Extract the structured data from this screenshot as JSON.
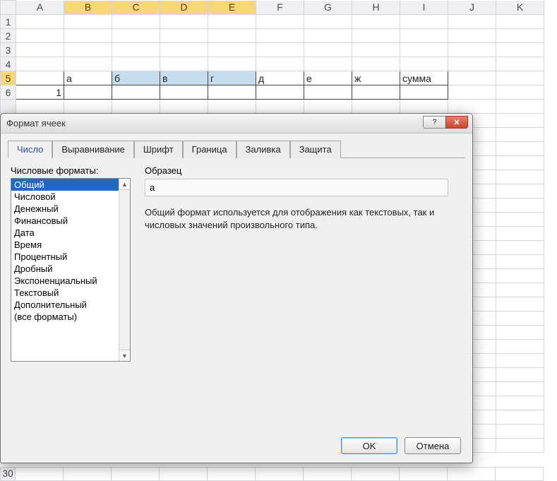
{
  "sheet": {
    "columns": [
      "A",
      "B",
      "C",
      "D",
      "E",
      "F",
      "G",
      "H",
      "I",
      "J",
      "K"
    ],
    "rows_visible": [
      "1",
      "2",
      "3",
      "4",
      "5",
      "6"
    ],
    "bottom_row_label": "30",
    "row5": {
      "A": "",
      "B": "а",
      "C": "б",
      "D": "в",
      "E": "г",
      "F": "д",
      "G": "е",
      "H": "ж",
      "I": "сумма"
    },
    "row6": {
      "A": "1"
    },
    "selected_cols": [
      "B",
      "C",
      "D",
      "E"
    ],
    "selected_row": "5"
  },
  "dialog": {
    "title": "Формат ячеек",
    "tabs": [
      "Число",
      "Выравнивание",
      "Шрифт",
      "Граница",
      "Заливка",
      "Защита"
    ],
    "active_tab": "Число",
    "formats_label": "Числовые форматы:",
    "formats": [
      "Общий",
      "Числовой",
      "Денежный",
      "Финансовый",
      "Дата",
      "Время",
      "Процентный",
      "Дробный",
      "Экспоненциальный",
      "Текстовый",
      "Дополнительный",
      "(все форматы)"
    ],
    "selected_format": "Общий",
    "sample_label": "Образец",
    "sample_value": "а",
    "description": "Общий формат используется для отображения как текстовых, так и числовых значений произвольного типа.",
    "ok_label": "OK",
    "cancel_label": "Отмена",
    "help_glyph": "?",
    "close_glyph": "✕"
  }
}
